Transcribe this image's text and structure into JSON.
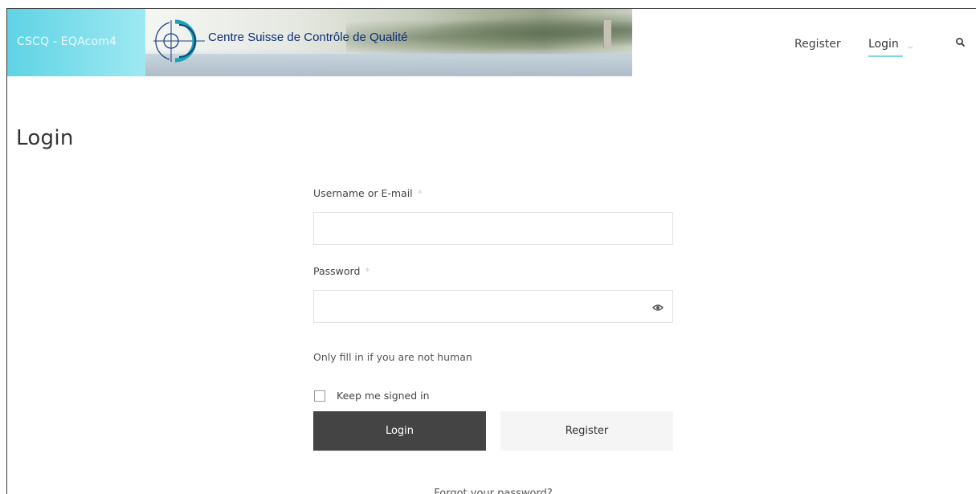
{
  "header": {
    "site_name": "CSCQ - EQAcom4",
    "banner_text": "Centre Suisse de Contrôle de Qualité",
    "nav": {
      "register": "Register",
      "login": "Login"
    }
  },
  "page": {
    "title": "Login"
  },
  "form": {
    "username_label": "Username or E-mail",
    "username_required_mark": "*",
    "username_value": "",
    "password_label": "Password",
    "password_required_mark": "*",
    "password_value": "",
    "honeypot_label": "Only fill in if you are not human",
    "remember_label": "Keep me signed in",
    "remember_checked": false,
    "login_button": "Login",
    "register_button": "Register",
    "forgot_link": "Forgot your password?"
  },
  "icons": {
    "search": "search-icon",
    "show_password": "eye-icon",
    "login_chevron": "chevron-down-icon",
    "logo": "crosshair-logo"
  },
  "colors": {
    "brand_cyan": "#5fd3e4",
    "banner_text": "#0f2f73",
    "login_button_bg": "#444444",
    "register_button_bg": "#f5f5f5",
    "nav_active_underline": "#7fd6df"
  }
}
